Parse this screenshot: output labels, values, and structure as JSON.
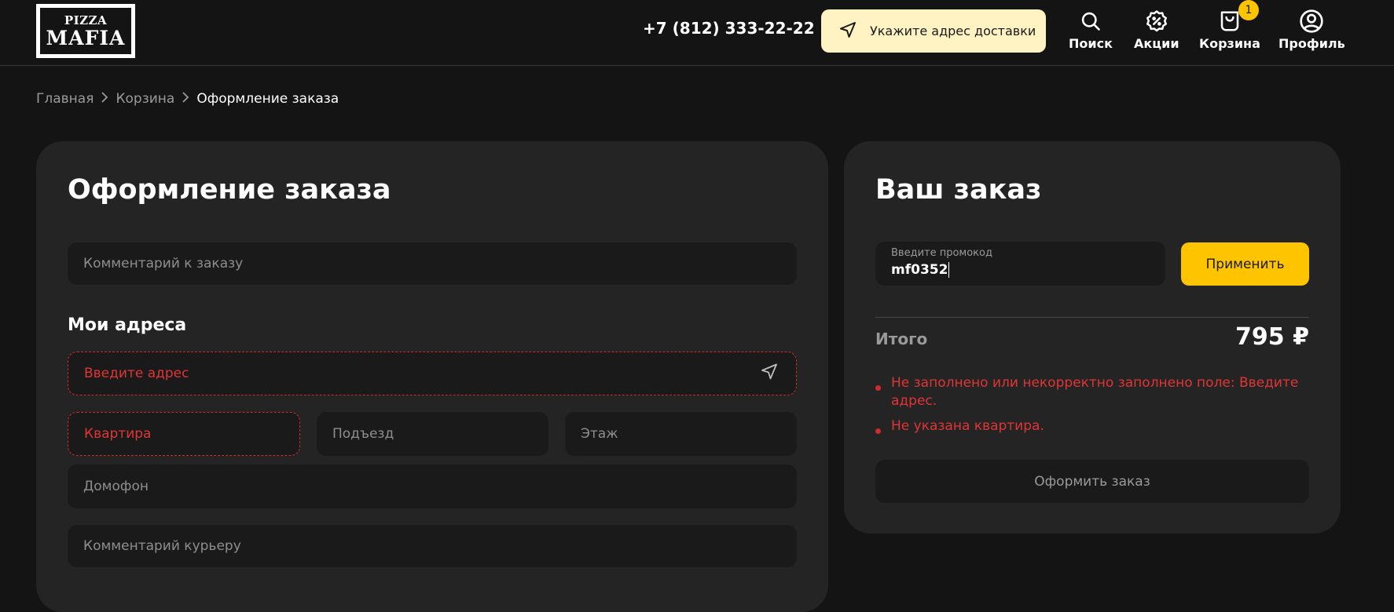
{
  "header": {
    "logo": {
      "line1": "PIZZA",
      "line2": "MAFIA"
    },
    "phone": "+7 (812) 333-22-22",
    "delivery_button": "Укажите адрес доставки",
    "nav": [
      {
        "label": "Поиск",
        "icon": "search-icon"
      },
      {
        "label": "Акции",
        "icon": "discount-icon"
      },
      {
        "label": "Корзина",
        "icon": "cart-icon",
        "badge": "1"
      },
      {
        "label": "Профиль",
        "icon": "profile-icon"
      }
    ]
  },
  "breadcrumb": [
    "Главная",
    "Корзина",
    "Оформление заказа"
  ],
  "checkout": {
    "title": "Оформление заказа",
    "comment_placeholder": "Комментарий к заказу",
    "addresses_title": "Мои адреса",
    "address_placeholder": "Введите адрес",
    "apartment_placeholder": "Квартира",
    "entrance_placeholder": "Подъезд",
    "floor_placeholder": "Этаж",
    "intercom_placeholder": "Домофон",
    "courier_comment_placeholder": "Комментарий курьеру"
  },
  "order": {
    "title": "Ваш заказ",
    "promo_label": "Введите промокод",
    "promo_value": "mf0352",
    "apply_button": "Применить",
    "total_label": "Итого",
    "total_value": "795 ₽",
    "errors": [
      "Не заполнено или некорректно заполнено поле: Введите адрес.",
      "Не указана квартира."
    ],
    "submit_button": "Оформить заказ"
  },
  "colors": {
    "background": "#141414",
    "card": "#242424",
    "field": "#1a1a1a",
    "accent": "#ffc400",
    "accent_light": "#fff3c4",
    "error": "#e03535"
  }
}
